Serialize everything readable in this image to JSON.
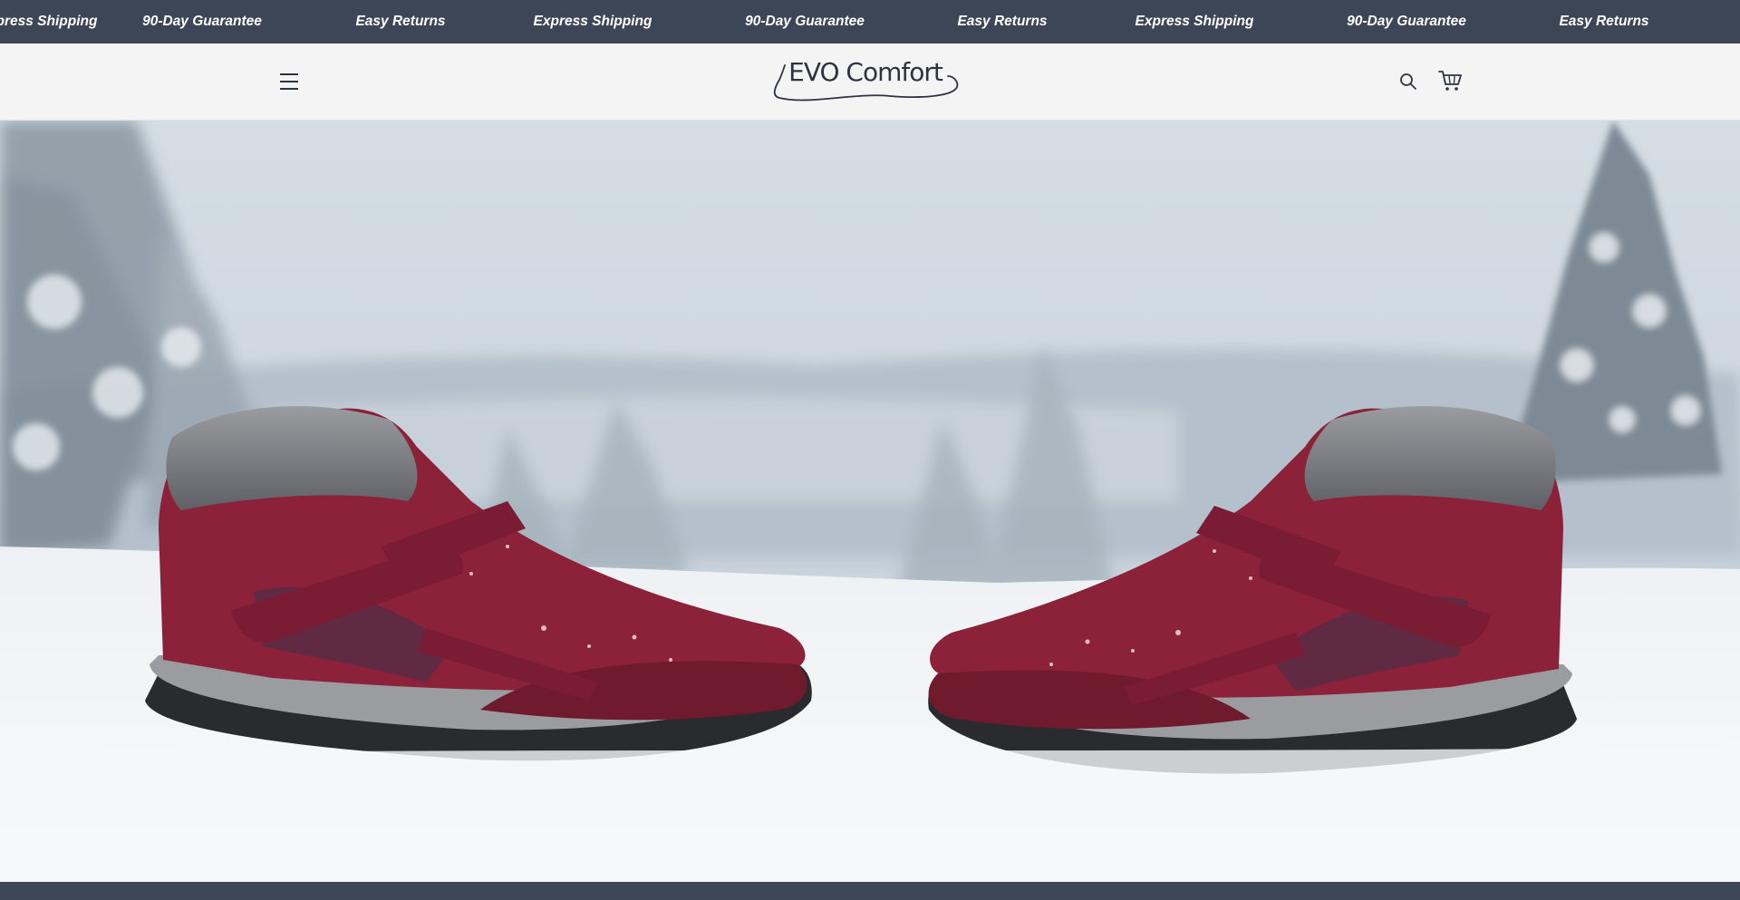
{
  "announcement_bar": {
    "background": "#3d4656",
    "items": [
      "Express Shipping",
      "90-Day Guarantee",
      "Easy Returns",
      "Express Shipping",
      "90-Day Guarantee",
      "Easy Returns",
      "Express Shipping",
      "90-Day Guarantee",
      "Easy Returns"
    ]
  },
  "header": {
    "logo_text": "EVO Comfort",
    "menu_icon": "hamburger-menu-icon",
    "search_icon": "search-icon",
    "cart_icon": "cart-icon"
  },
  "hero": {
    "image": "pair of burgundy fur-lined winter boots on snow with snowy pine forest background"
  },
  "colors": {
    "dark_bar": "#3d4656",
    "header_bg": "#f4f4f4",
    "logo_text": "#2e3342",
    "boot_red": "#8c2239"
  }
}
